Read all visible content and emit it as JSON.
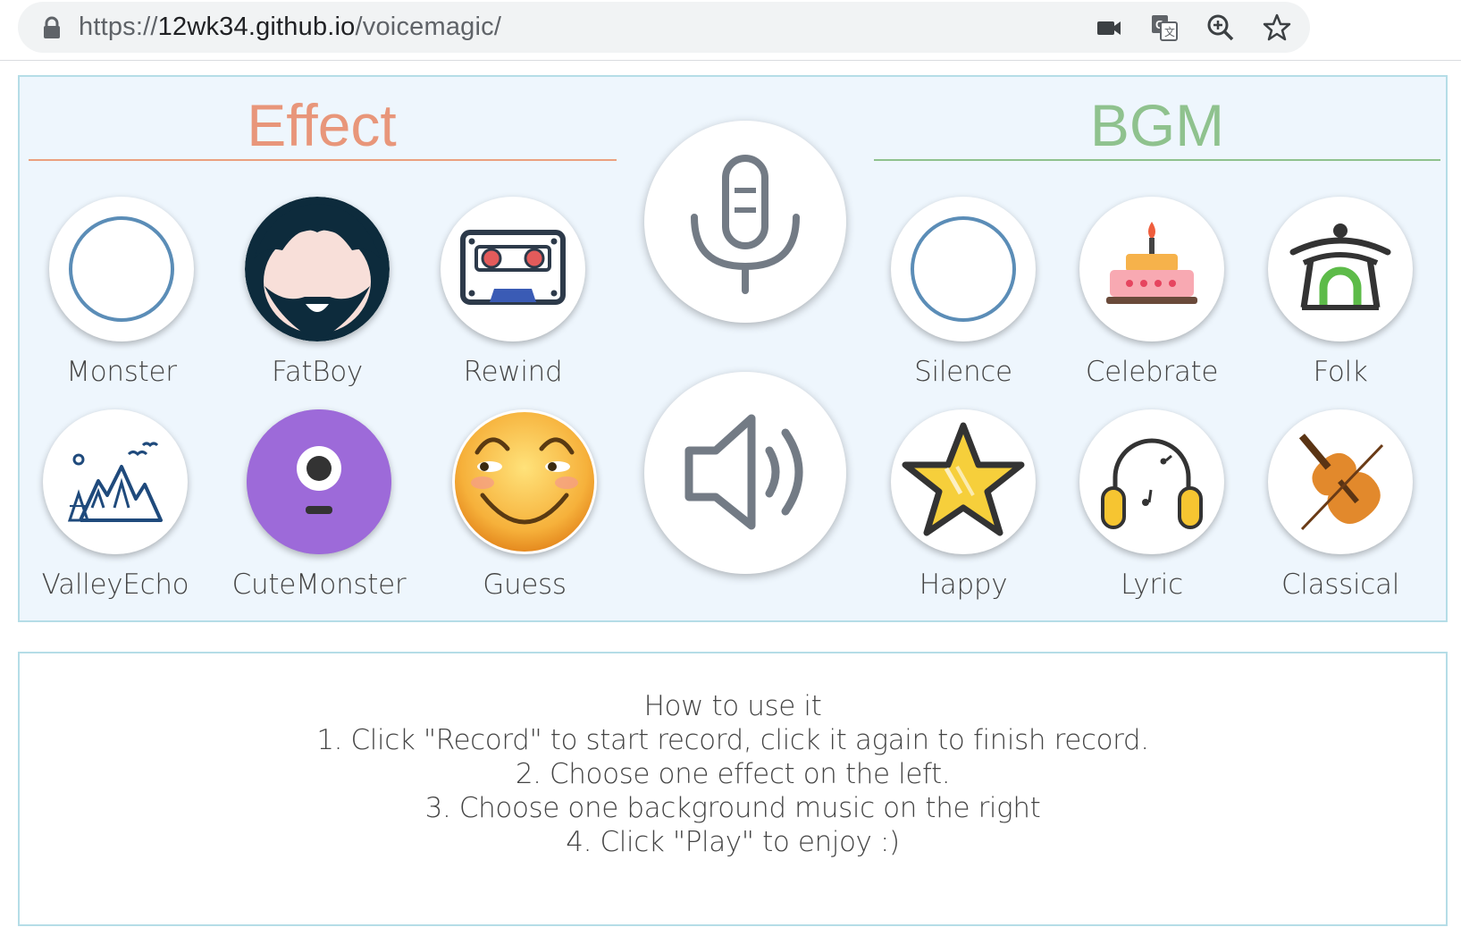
{
  "browser": {
    "url_scheme": "https://",
    "url_host": "12wk34.github.io",
    "url_path": "/voicemagic/",
    "icons": [
      "lock-icon",
      "camera-icon",
      "translate-icon",
      "zoom-icon",
      "star-icon"
    ]
  },
  "effect": {
    "title": "Effect",
    "color": "#e8967a",
    "items": [
      {
        "label": "Monster",
        "icon": "ring-icon"
      },
      {
        "label": "FatBoy",
        "icon": "bearded-face-icon"
      },
      {
        "label": "Rewind",
        "icon": "cassette-icon"
      },
      {
        "label": "ValleyEcho",
        "icon": "mountains-icon"
      },
      {
        "label": "CuteMonster",
        "icon": "one-eyed-monster-icon"
      },
      {
        "label": "Guess",
        "icon": "smirk-emoji-icon"
      }
    ]
  },
  "controls": {
    "record_icon": "microphone-icon",
    "play_icon": "speaker-icon"
  },
  "bgm": {
    "title": "BGM",
    "color": "#8fc28e",
    "items": [
      {
        "label": "Silence",
        "icon": "ring-icon"
      },
      {
        "label": "Celebrate",
        "icon": "cake-icon"
      },
      {
        "label": "Folk",
        "icon": "pavilion-icon"
      },
      {
        "label": "Happy",
        "icon": "star-icon"
      },
      {
        "label": "Lyric",
        "icon": "headphones-icon"
      },
      {
        "label": "Classical",
        "icon": "violin-icon"
      }
    ]
  },
  "instructions": {
    "heading": "How to use it",
    "steps": [
      "1. Click \"Record\" to start record, click it again to finish record.",
      "2. Choose one effect on the left.",
      "3. Choose one background music on the right",
      "4. Click \"Play\" to enjoy :)"
    ]
  }
}
